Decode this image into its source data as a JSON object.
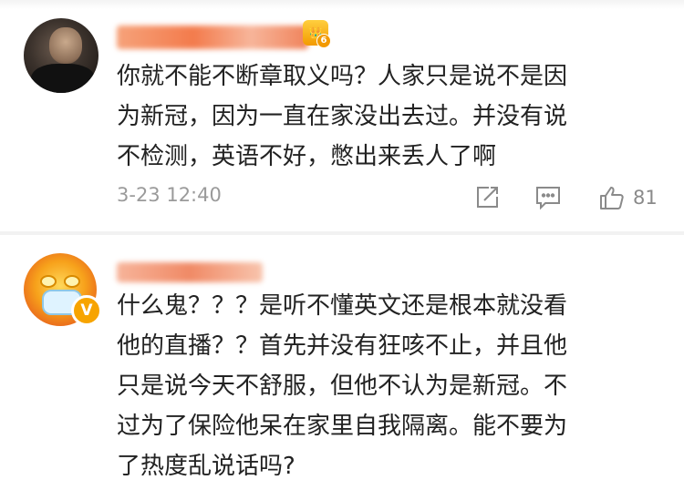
{
  "comments": [
    {
      "text": "你就不能不断章取义吗？人家只是说不是因\n为新冠，因为一直在家没出去过。并没有说\n不检测，英语不好，憋出来丢人了啊",
      "vip_level": "6",
      "timestamp": "3-23 12:40",
      "like_count": "81"
    },
    {
      "text": "什么鬼？？？是听不懂英文还是根本就没看\n他的直播？？首先并没有狂咳不止，并且他\n只是说今天不舒服，但他不认为是新冠。不\n过为了保险他呆在家里自我隔离。能不要为\n了热度乱说话吗?",
      "verified_badge": "V"
    }
  ],
  "icons": [
    "share-icon",
    "comment-icon",
    "like-icon"
  ],
  "colors": {
    "username_blur": "#f37b4c",
    "vip": "#f39a00",
    "meta": "#9a9a9a",
    "divider": "#f2f2f2"
  }
}
